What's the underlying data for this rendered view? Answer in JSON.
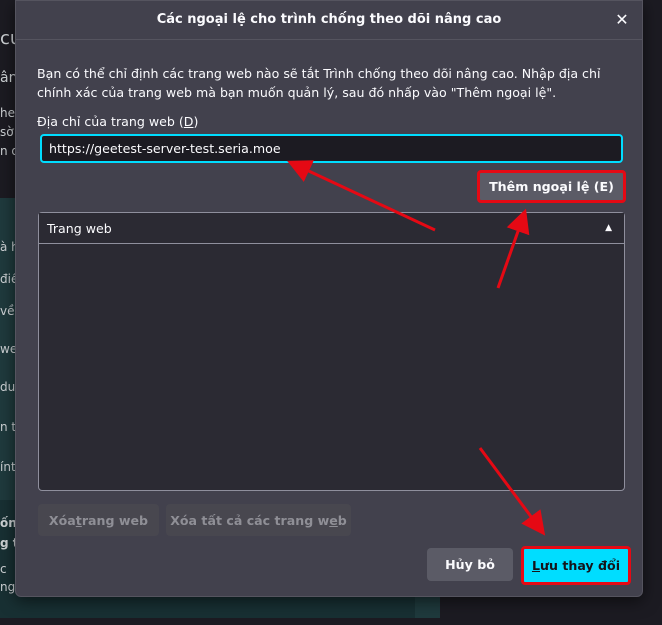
{
  "background": {
    "fragments": [
      "cu",
      "ân",
      "he",
      "sờ",
      "n d",
      "à h",
      "điể",
      "vền",
      "we",
      "du",
      "n ti",
      "ínt",
      "ốn",
      "g t",
      "c",
      "ng"
    ]
  },
  "dialog": {
    "title": "Các ngoại lệ cho trình chống theo dõi nâng cao",
    "close_glyph": "✕",
    "description": "Bạn có thể chỉ định các trang web nào sẽ tắt Trình chống theo dõi nâng cao. Nhập địa chỉ chính xác của trang web mà bạn muốn quản lý, sau đó nhấp vào \"Thêm ngoại lệ\".",
    "address_label_prefix": "Địa chỉ của trang web (",
    "address_label_key": "D",
    "address_label_suffix": ")",
    "address_value": "https://geetest-server-test.seria.moe",
    "add_button": "Thêm ngoại lệ (E)",
    "table": {
      "column_header": "Trang web",
      "sort_glyph": "▲",
      "rows": []
    },
    "remove_button_prefix": "Xóa ",
    "remove_button_key": "t",
    "remove_button_suffix": "rang web",
    "remove_all_button_prefix": "Xóa tất cả các trang w",
    "remove_all_button_key": "e",
    "remove_all_button_suffix": "b",
    "cancel_button": "Hủy bỏ",
    "save_button_key": "L",
    "save_button_suffix": "ưu thay đổi"
  },
  "colors": {
    "accent": "#00ddff",
    "annotation_red": "#e50914",
    "dialog_bg": "#42414d"
  }
}
